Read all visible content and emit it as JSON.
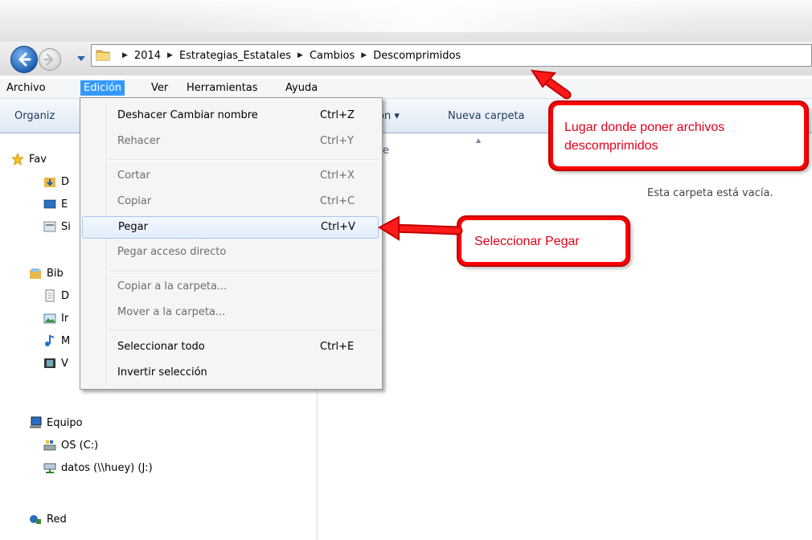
{
  "address": {
    "crumbs": [
      "2014",
      "Estrategias_Estatales",
      "Cambios",
      "Descomprimidos"
    ]
  },
  "menubar": {
    "items": [
      "Archivo",
      "Edición",
      "Ver",
      "Herramientas",
      "Ayuda"
    ]
  },
  "toolbar": {
    "organize": "Organiz",
    "partial": "on ▾",
    "new_folder": "Nueva carpeta"
  },
  "edit_menu": {
    "items": [
      {
        "label": "Deshacer Cambiar nombre",
        "shortcut": "Ctrl+Z"
      },
      {
        "label": "Rehacer",
        "shortcut": "Ctrl+Y"
      },
      {
        "label": "Cortar",
        "shortcut": "Ctrl+X"
      },
      {
        "label": "Copiar",
        "shortcut": "Ctrl+C"
      },
      {
        "label": "Pegar",
        "shortcut": "Ctrl+V"
      },
      {
        "label": "Pegar acceso directo",
        "shortcut": ""
      },
      {
        "label": "Copiar a la carpeta...",
        "shortcut": ""
      },
      {
        "label": "Mover a la carpeta...",
        "shortcut": ""
      },
      {
        "label": "Seleccionar todo",
        "shortcut": "Ctrl+E"
      },
      {
        "label": "Invertir selección",
        "shortcut": ""
      }
    ]
  },
  "navpane": {
    "favorites": "Fav",
    "fav_items": [
      "D",
      "E",
      "Si"
    ],
    "libraries": "Bib",
    "lib_items": [
      "D",
      "Ir",
      "M",
      "V"
    ],
    "computer": "Equipo",
    "drives": [
      "OS (C:)",
      "datos (\\\\huey) (J:)"
    ],
    "network": "Red"
  },
  "content": {
    "header_partial": "e",
    "empty_text": "Esta carpeta está vacía."
  },
  "callouts": {
    "location": "Lugar donde poner archivos descomprimidos",
    "paste": "Seleccionar Pegar"
  },
  "colors": {
    "accent": "#3399ff",
    "callout_red": "#ff0000"
  }
}
